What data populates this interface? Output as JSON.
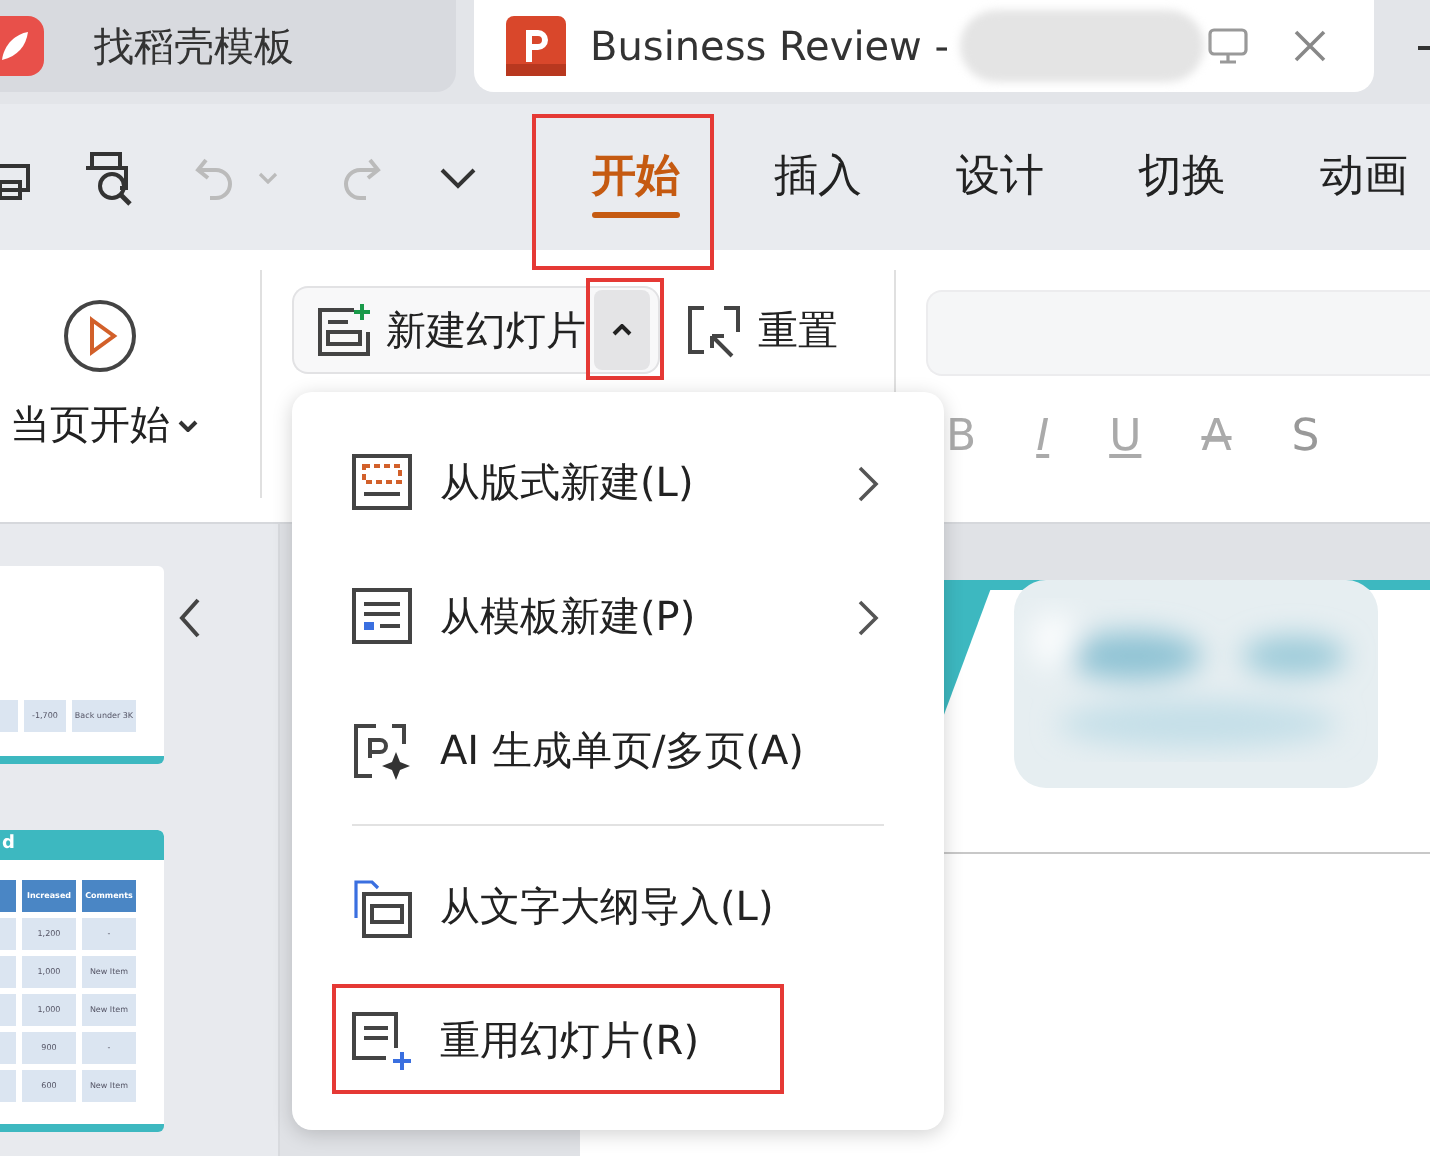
{
  "browser_tabs": [
    {
      "kind": "docer",
      "title": "找稻壳模板",
      "selected": false,
      "redacted": false
    },
    {
      "kind": "presentation",
      "title": "Business Review -",
      "selected": true,
      "redacted": true
    }
  ],
  "ribbon_tabs": [
    {
      "label": "开始",
      "selected": true,
      "annotated": true
    },
    {
      "label": "插入",
      "selected": false,
      "annotated": false
    },
    {
      "label": "设计",
      "selected": false,
      "annotated": false
    },
    {
      "label": "切换",
      "selected": false,
      "annotated": false
    },
    {
      "label": "动画",
      "selected": false,
      "annotated": false
    }
  ],
  "ribbon": {
    "play_from_current": "当页开始",
    "new_slide": {
      "label": "新建幻灯片",
      "menu_open": true,
      "caret_annotated": true
    },
    "reset": "重置",
    "format_buttons": [
      {
        "kind": "bold",
        "label": "B"
      },
      {
        "kind": "italic",
        "label": "I"
      },
      {
        "kind": "underline",
        "label": "U"
      },
      {
        "kind": "strike",
        "label": "A"
      },
      {
        "kind": "shadow",
        "label": "S"
      }
    ]
  },
  "new_slide_menu": [
    {
      "kind": "item",
      "label": "从版式新建(L)",
      "submenu": true,
      "annotated": false
    },
    {
      "kind": "item",
      "label": "从模板新建(P)",
      "submenu": true,
      "annotated": false
    },
    {
      "kind": "item",
      "label": "AI 生成单页/多页(A)",
      "submenu": false,
      "annotated": false
    },
    {
      "kind": "separator"
    },
    {
      "kind": "item",
      "label": "从文字大纲导入(L)",
      "submenu": false,
      "annotated": false
    },
    {
      "kind": "item",
      "label": "重用幻灯片(R)",
      "submenu": false,
      "annotated": true
    }
  ],
  "slide_thumbnails": [
    {
      "rows": [
        [
          "-1,700",
          "Back under 3K"
        ]
      ]
    },
    {
      "title": "d",
      "columns": [
        "Increased",
        "Comments"
      ],
      "rows": [
        [
          "1,200",
          "-"
        ],
        [
          "1,000",
          "New Item"
        ],
        [
          "1,000",
          "New Item"
        ],
        [
          "900",
          "-"
        ],
        [
          "600",
          "New Item"
        ]
      ]
    }
  ]
}
